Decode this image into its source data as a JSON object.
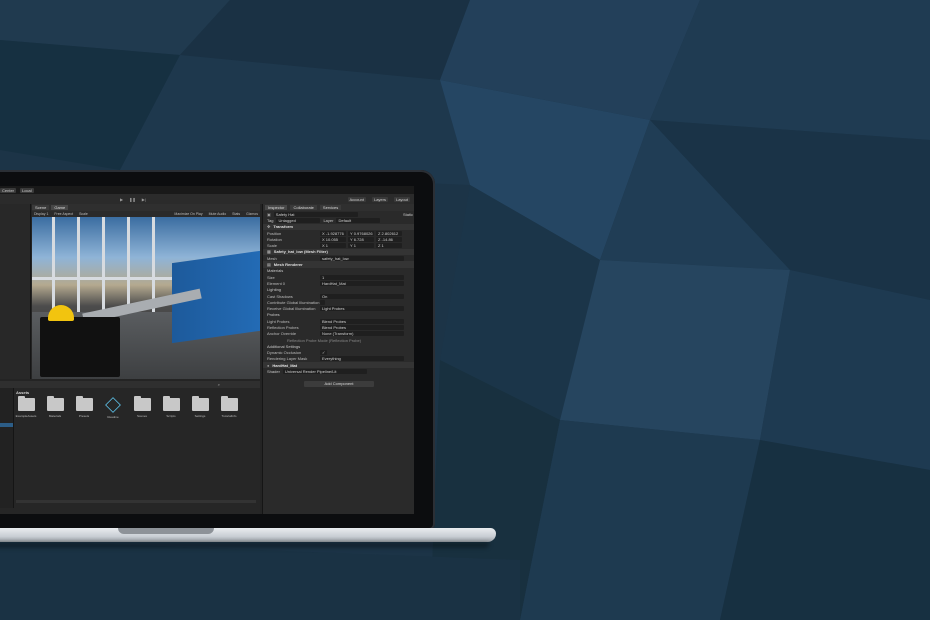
{
  "editor": {
    "topbar": {
      "center_label": "Center",
      "local_label": "Local"
    },
    "toolbar": {
      "account": "Account",
      "layers": "Layers",
      "layout": "Layout"
    },
    "scene_tabs": [
      "Scene",
      "Game"
    ],
    "game_bar": {
      "display": "Display 1",
      "aspect": "Free Aspect",
      "scale": "Scale",
      "maximize": "Maximize On Play",
      "mute": "Mute Audio",
      "stats": "Stats",
      "gizmos": "Gizmos"
    },
    "project": {
      "heading": "Assets",
      "folders": [
        "ExampleAssets",
        "Materials",
        "Presets",
        "Readme",
        "Scenes",
        "Scripts",
        "Settings",
        "TutorialInfo"
      ]
    },
    "inspector": {
      "tabs": [
        "Inspector",
        "Collaborate",
        "Services"
      ],
      "object_name": "Safety Hat",
      "static_label": "Static",
      "tag_label": "Tag",
      "tag_value": "Untagged",
      "layer_label": "Layer",
      "layer_value": "Default",
      "transform": {
        "title": "Transform",
        "position": {
          "label": "Position",
          "x": "X -1.928776",
          "y": "Y 0.9768026",
          "z": "Z 2.802612"
        },
        "rotation": {
          "label": "Rotation",
          "x": "X 10.055",
          "y": "Y 6.728",
          "z": "Z -14.86"
        },
        "scale": {
          "label": "Scale",
          "x": "X 1",
          "y": "Y 1",
          "z": "Z 1"
        }
      },
      "mesh_filter": {
        "title": "Safety_hat_low (Mesh Filter)",
        "mesh_label": "Mesh",
        "mesh_value": "safety_hat_low"
      },
      "mesh_renderer": {
        "title": "Mesh Renderer",
        "materials": "Materials",
        "size_label": "Size",
        "size_value": "1",
        "element_label": "Element 0",
        "element_value": "HardHat_Mat",
        "lighting": "Lighting",
        "cast_shadows_label": "Cast Shadows",
        "cast_shadows_value": "On",
        "contribute_gi": "Contribute Global Illumination",
        "receive_gi_label": "Receive Global Illumination",
        "receive_gi_value": "Light Probes",
        "probes": "Probes",
        "light_probes_label": "Light Probes",
        "light_probes_value": "Blend Probes",
        "reflection_label": "Reflection Probes",
        "reflection_value": "Blend Probes",
        "anchor_label": "Anchor Override",
        "anchor_value": "None (Transform)",
        "refl_hint": "Reflection Probe Mode (Reflection Probe)",
        "additional": "Additional Settings",
        "dynamic_occ": "Dynamic Occlusion",
        "rendering_layer_label": "Rendering Layer Mask",
        "rendering_layer_value": "Everything"
      },
      "material": {
        "name": "HardHat_Mat",
        "shader_label": "Shader",
        "shader_value": "Universal Render Pipeline/Lit"
      },
      "add_component": "Add Component"
    }
  }
}
